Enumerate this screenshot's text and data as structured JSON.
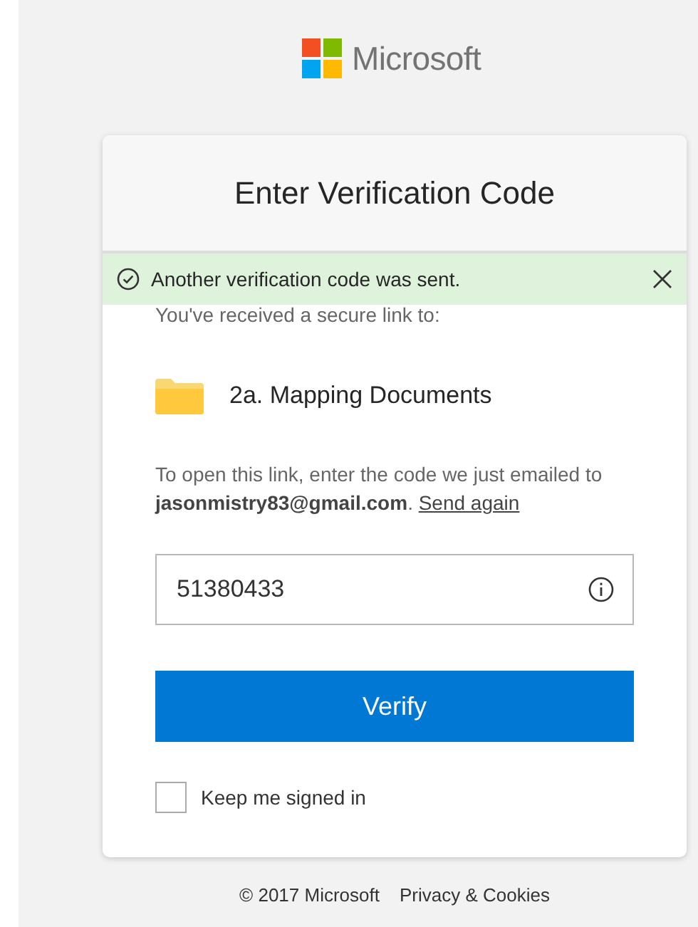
{
  "brand": {
    "name": "Microsoft"
  },
  "card": {
    "title": "Enter Verification Code",
    "notification": {
      "kind": "success",
      "text": "Another verification code was sent."
    },
    "intro": "You've received a secure link to:",
    "item": {
      "kind": "folder",
      "name": "2a. Mapping Documents"
    },
    "instruction": "To open this link, enter the code we just emailed to **jasonmistry83@gmail.com**.",
    "resend_link": "Send again",
    "code_field": {
      "value": "51380433"
    },
    "verify_button": "Verify",
    "keep_signed_in": {
      "label": "Keep me signed in",
      "checked": false
    }
  },
  "footer": {
    "copyright": "© 2017 Microsoft",
    "link": "Privacy & Cookies"
  }
}
